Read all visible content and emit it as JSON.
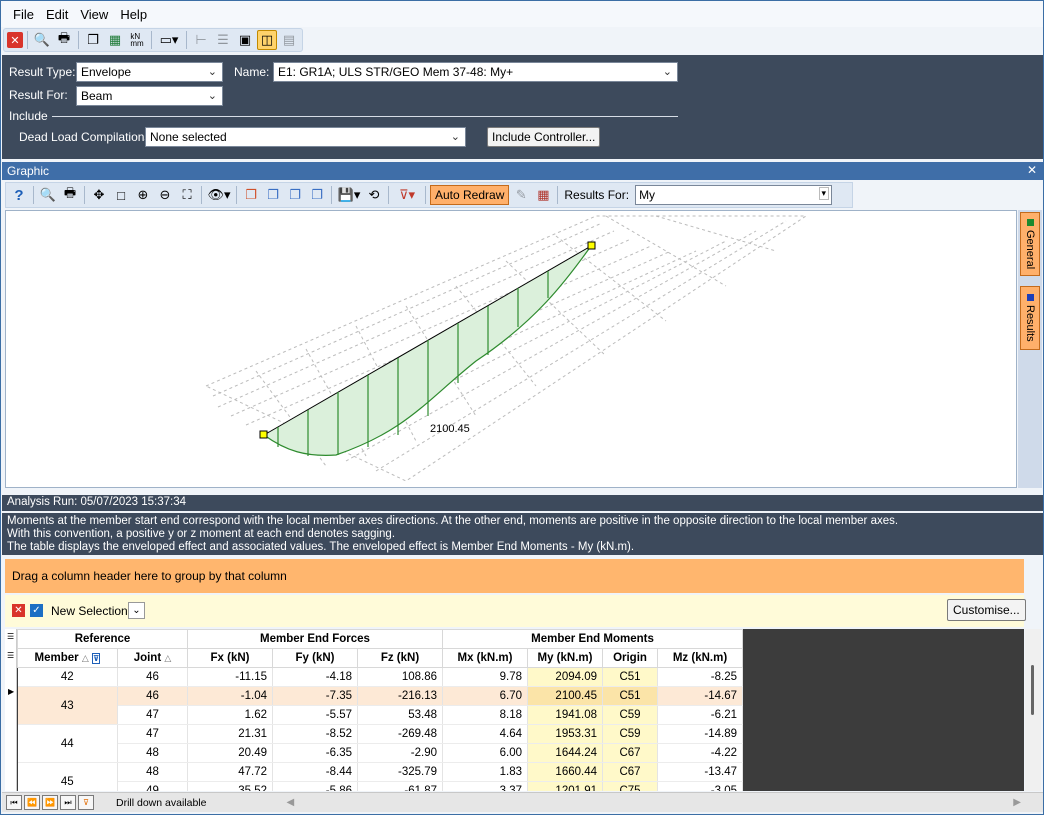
{
  "menu": [
    "File",
    "Edit",
    "View",
    "Help"
  ],
  "top": {
    "result_type_label": "Result Type:",
    "result_type_value": "Envelope",
    "name_label": "Name:",
    "name_value": "E1: GR1A; ULS STR/GEO Mem 37-48: My+",
    "result_for_label": "Result For:",
    "result_for_value": "Beam",
    "include_label": "Include",
    "dead_load_label": "Dead Load Compilations:",
    "dead_load_value": "None selected",
    "include_controller_button": "Include Controller..."
  },
  "graphic": {
    "panel_title": "Graphic",
    "close_glyph": "✕",
    "auto_redraw": "Auto Redraw",
    "results_for_label": "Results For:",
    "results_for_value": "My",
    "diagram_label": "2100.45",
    "side_tabs": [
      "General",
      "Results"
    ],
    "accent_color": "#ffb06b",
    "diagram_color": "#2e8b2e"
  },
  "info": {
    "analysis_run": "Analysis Run: 05/07/2023 15:37:34",
    "note_line1": "Moments at the member start end correspond with the local member axes directions. At the other end, moments are positive in the opposite direction to the local member axes.",
    "note_line2": "With this convention, a positive y or z moment at each end denotes sagging.",
    "note_line3": "The table displays the enveloped effect and associated values. The enveloped effect is Member End Moments - My (kN.m)."
  },
  "grid": {
    "group_hint": "Drag a column header here to group by that column",
    "new_selection": "New Selection",
    "customise_button": "Customise...",
    "group_headers": [
      "Reference",
      "Member End Forces",
      "Member End Moments"
    ],
    "columns": [
      "Member",
      "Joint",
      "Fx (kN)",
      "Fy (kN)",
      "Fz (kN)",
      "Mx (kN.m)",
      "My (kN.m)",
      "Origin",
      "Mz (kN.m)"
    ],
    "rows": [
      {
        "member": "42",
        "joint": "46",
        "fx": "-11.15",
        "fy": "-4.18",
        "fz": "108.86",
        "mx": "9.78",
        "my": "2094.09",
        "origin": "C51",
        "mz": "-8.25"
      },
      {
        "member": "43",
        "joint": "46",
        "fx": "-1.04",
        "fy": "-7.35",
        "fz": "-216.13",
        "mx": "6.70",
        "my": "2100.45",
        "origin": "C51",
        "mz": "-14.67"
      },
      {
        "member": "",
        "joint": "47",
        "fx": "1.62",
        "fy": "-5.57",
        "fz": "53.48",
        "mx": "8.18",
        "my": "1941.08",
        "origin": "C59",
        "mz": "-6.21"
      },
      {
        "member": "44",
        "joint": "47",
        "fx": "21.31",
        "fy": "-8.52",
        "fz": "-269.48",
        "mx": "4.64",
        "my": "1953.31",
        "origin": "C59",
        "mz": "-14.89"
      },
      {
        "member": "",
        "joint": "48",
        "fx": "20.49",
        "fy": "-6.35",
        "fz": "-2.90",
        "mx": "6.00",
        "my": "1644.24",
        "origin": "C67",
        "mz": "-4.22"
      },
      {
        "member": "45",
        "joint": "48",
        "fx": "47.72",
        "fy": "-8.44",
        "fz": "-325.79",
        "mx": "1.83",
        "my": "1660.44",
        "origin": "C67",
        "mz": "-13.47"
      },
      {
        "member": "",
        "joint": "49",
        "fx": "35.52",
        "fy": "-5.86",
        "fz": "-61.87",
        "mx": "3.37",
        "my": "1201.91",
        "origin": "C75",
        "mz": "-3.05"
      }
    ],
    "drill_down": "Drill down available"
  }
}
